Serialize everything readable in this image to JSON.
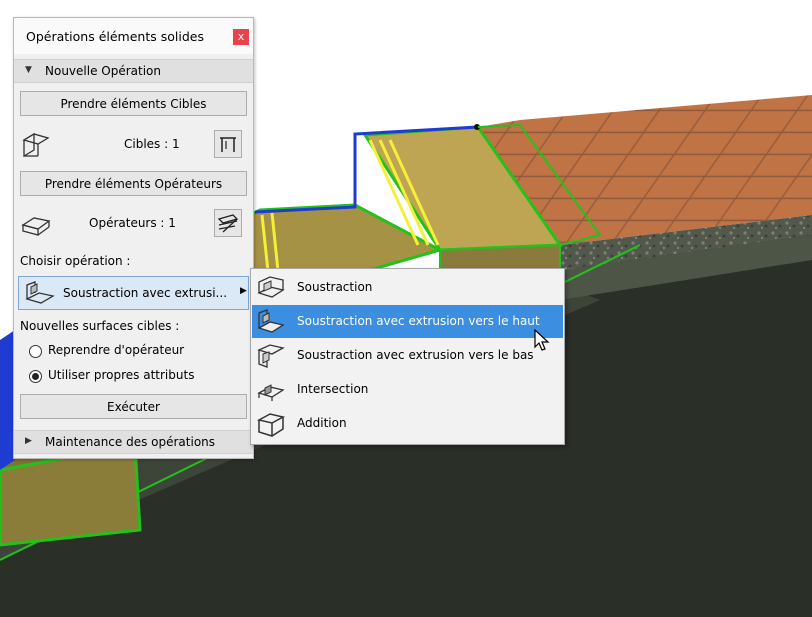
{
  "panel": {
    "title": "Opérations éléments solides",
    "close_label": "x",
    "section_new": "Nouvelle Opération",
    "take_targets_button": "Prendre éléments Cibles",
    "targets_label": "Cibles : 1",
    "take_operators_button": "Prendre éléments Opérateurs",
    "operators_label": "Opérateurs : 1",
    "choose_operation_label": "Choisir opération :",
    "operation_selected": "Soustraction avec extrusi...",
    "new_surfaces_label": "Nouvelles surfaces cibles :",
    "radio_options": [
      {
        "label": "Reprendre d'opérateur",
        "checked": false
      },
      {
        "label": "Utiliser propres attributs",
        "checked": true
      }
    ],
    "execute_button": "Exécuter",
    "section_maintenance": "Maintenance des opérations"
  },
  "menu": {
    "items": [
      {
        "label": "Soustraction",
        "icon": "subtraction-icon",
        "selected": false
      },
      {
        "label": "Soustraction avec extrusion vers le haut",
        "icon": "subtraction-upward-icon",
        "selected": true
      },
      {
        "label": "Soustraction avec extrusion vers le bas",
        "icon": "subtraction-downward-icon",
        "selected": false
      },
      {
        "label": "Intersection",
        "icon": "intersection-icon",
        "selected": false
      },
      {
        "label": "Addition",
        "icon": "addition-icon",
        "selected": false
      }
    ]
  },
  "colors": {
    "close_button": "#e8424b",
    "selection": "#3b8ee0",
    "dropdown_bg": "#dbe8f6",
    "target_outline": "#1f3bd1",
    "operator_outline": "#22c21a",
    "stair_fill": "#b8a24a",
    "tile": "#b5673c"
  }
}
